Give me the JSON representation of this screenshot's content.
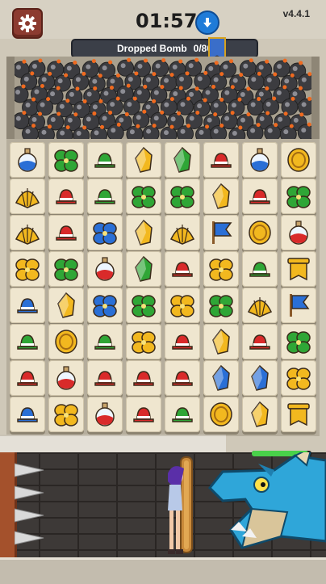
{
  "hud": {
    "timer": "01:57",
    "version": "v4.4.1"
  },
  "goal": {
    "label": "Dropped Bomb",
    "progress": "0/80"
  },
  "board": {
    "rows": [
      [
        "potion-blue",
        "leaf-green",
        "hat-green",
        "crystal-yellow",
        "crystal-green",
        "hat-red",
        "potion-blue",
        "coin-yellow"
      ],
      [
        "shell-yellow",
        "hat-red",
        "hat-green",
        "leaf-green",
        "leaf-green",
        "crystal-yellow",
        "hat-red",
        "leaf-green"
      ],
      [
        "shell-yellow",
        "hat-red",
        "leaf-blue",
        "crystal-yellow",
        "shell-yellow",
        "flag-blue",
        "coin-yellow",
        "potion-red"
      ],
      [
        "leaf-yellow",
        "leaf-green",
        "potion-red",
        "crystal-green",
        "hat-red",
        "leaf-yellow",
        "hat-green",
        "banner-yellow"
      ],
      [
        "hat-blue",
        "crystal-yellow",
        "leaf-blue",
        "leaf-green",
        "leaf-yellow",
        "leaf-green",
        "shell-yellow",
        "flag-blue"
      ],
      [
        "hat-green",
        "coin-yellow",
        "hat-green",
        "leaf-yellow",
        "hat-red",
        "crystal-yellow",
        "hat-red",
        "leaf-green"
      ],
      [
        "hat-red",
        "potion-red",
        "hat-red",
        "hat-red",
        "hat-red",
        "crystal-blue",
        "crystal-blue",
        "leaf-yellow"
      ],
      [
        "hat-blue",
        "leaf-yellow",
        "potion-red",
        "hat-red",
        "hat-green",
        "coin-yellow",
        "crystal-yellow",
        "banner-yellow"
      ]
    ]
  },
  "colors": {
    "red": "#d92a2a",
    "green": "#2fa636",
    "blue": "#2a6fd6",
    "yellow": "#f2b81f",
    "bomb": "#3c3c40",
    "fuse": "#f06a1f"
  },
  "hero": {
    "health_fraction": 0.95
  }
}
